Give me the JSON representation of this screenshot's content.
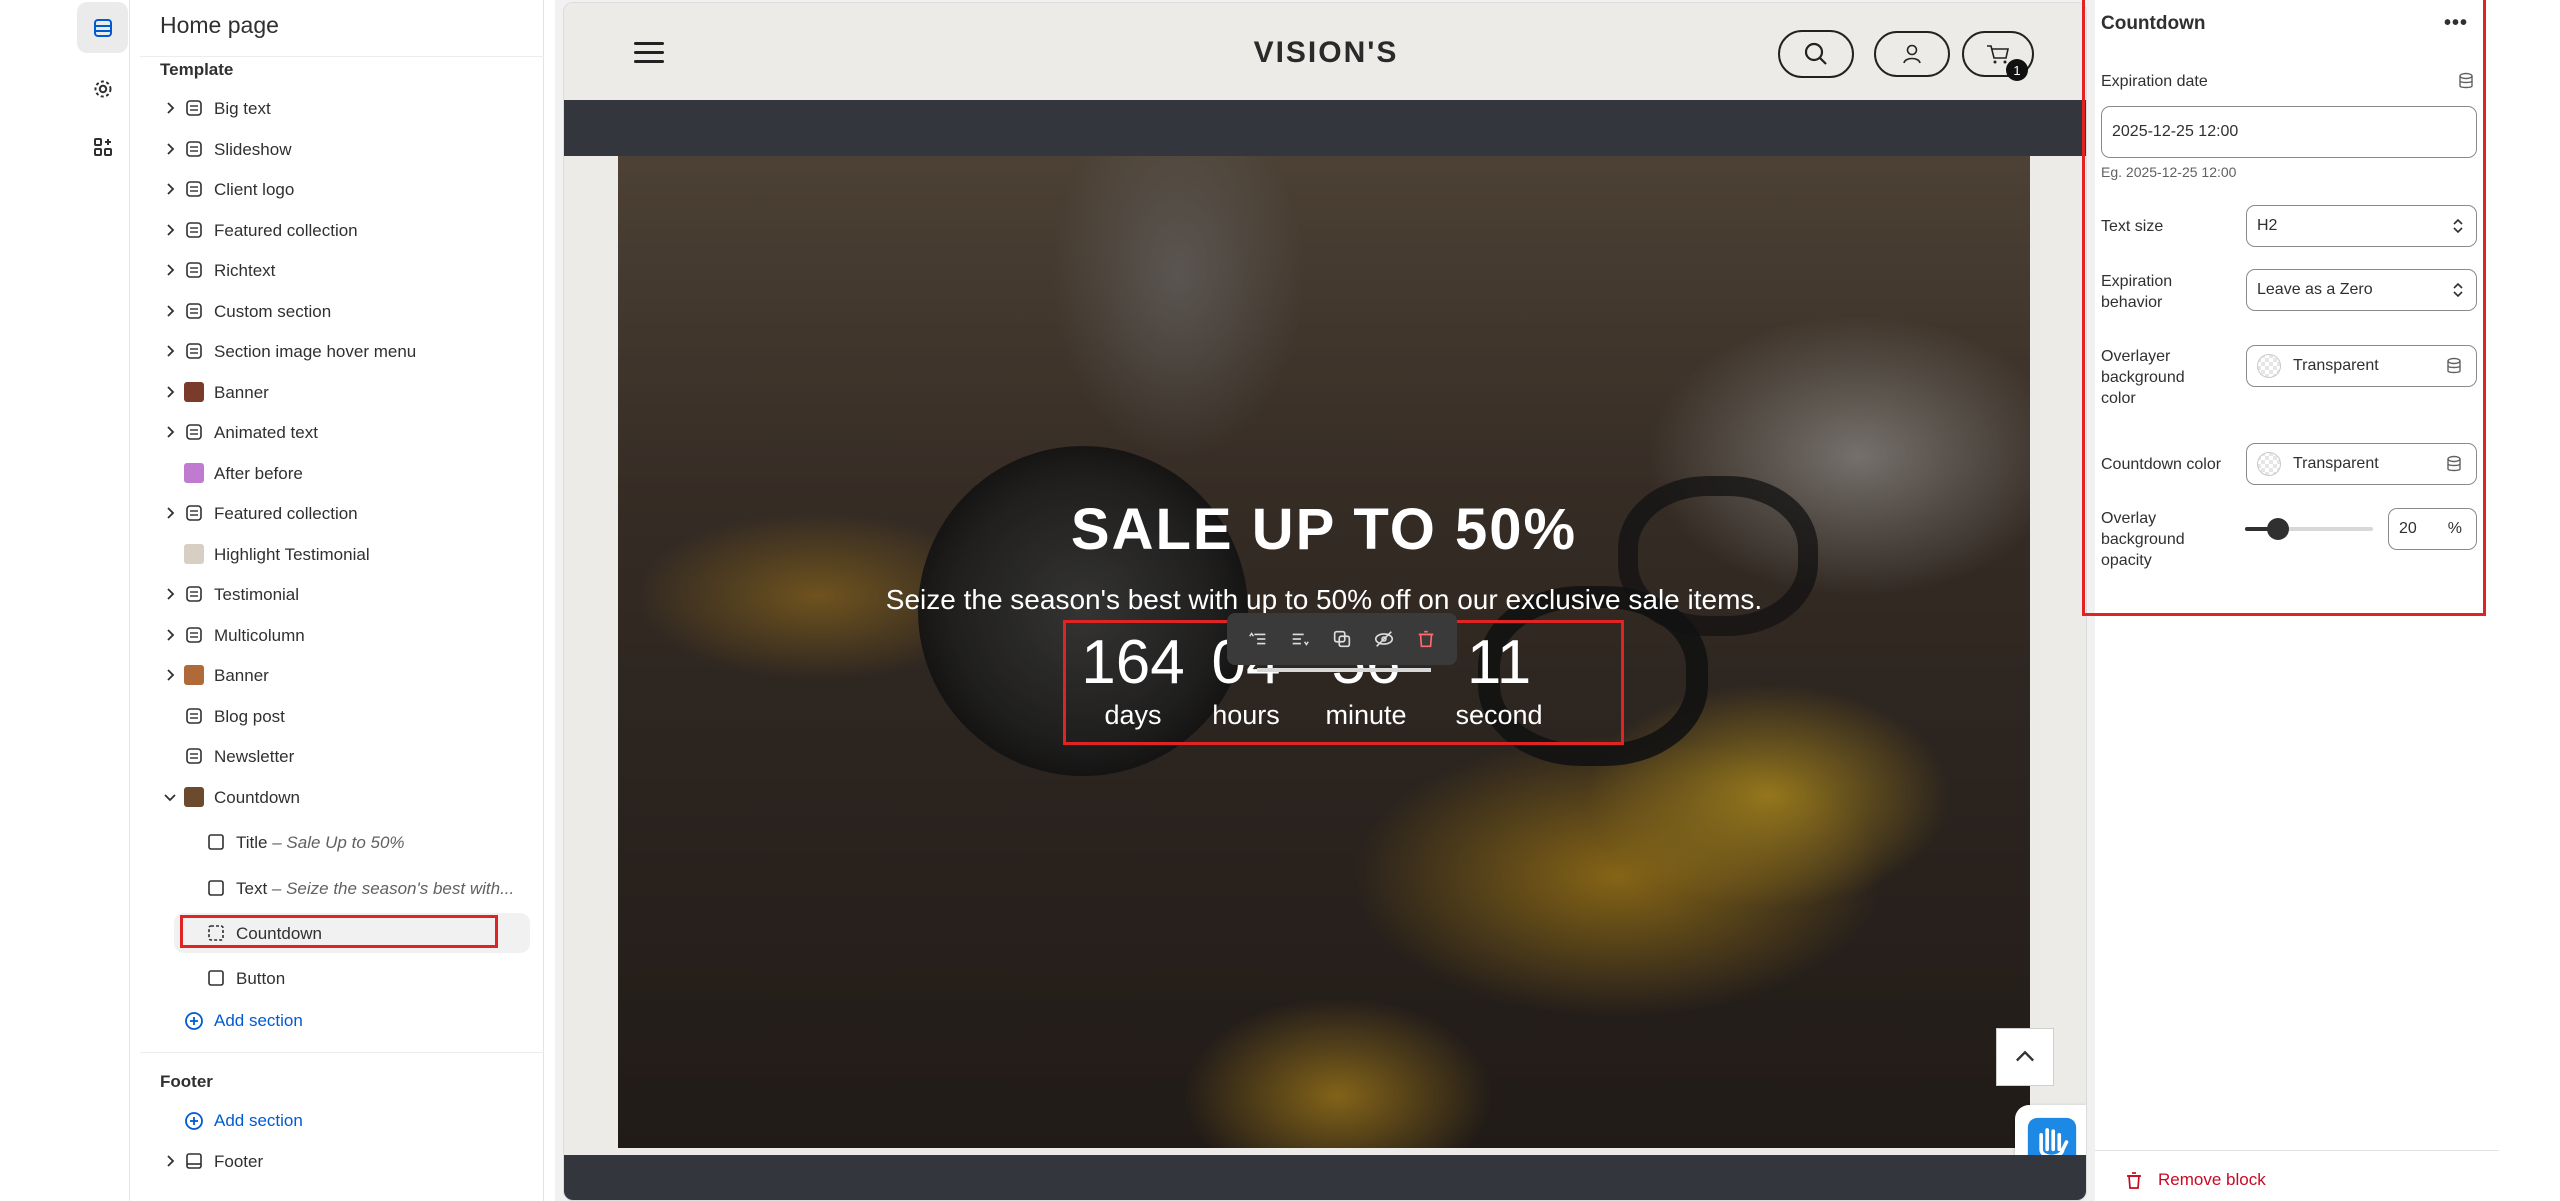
{
  "sidebar": {
    "title": "Home page",
    "template_heading": "Template",
    "items": [
      {
        "label": "Big text"
      },
      {
        "label": "Slideshow"
      },
      {
        "label": "Client logo"
      },
      {
        "label": "Featured collection"
      },
      {
        "label": "Richtext"
      },
      {
        "label": "Custom section"
      },
      {
        "label": "Section image hover menu"
      },
      {
        "label": "Banner"
      },
      {
        "label": "Animated text"
      },
      {
        "label": "After before"
      },
      {
        "label": "Featured collection"
      },
      {
        "label": "Highlight Testimonial"
      },
      {
        "label": "Testimonial"
      },
      {
        "label": "Multicolumn"
      },
      {
        "label": "Banner"
      },
      {
        "label": "Blog post"
      },
      {
        "label": "Newsletter"
      },
      {
        "label": "Countdown"
      }
    ],
    "countdown_children": [
      {
        "label": "Title",
        "sub": " – Sale Up to 50%"
      },
      {
        "label": "Text",
        "sub": " – Seize the season's best with..."
      },
      {
        "label": "Countdown",
        "sub": ""
      },
      {
        "label": "Button",
        "sub": ""
      }
    ],
    "add_section": "Add section",
    "footer_heading": "Footer",
    "footer_add_section": "Add section",
    "footer_item": "Footer"
  },
  "store": {
    "brand": "VISION'S",
    "cart_count": "1",
    "hero_title": "SALE UP TO 50%",
    "hero_text": "Seize the season's best with up to 50% off on our exclusive sale items.",
    "countdown": [
      {
        "value": "164",
        "label": "days"
      },
      {
        "value": "04",
        "label": "hours"
      },
      {
        "value": "56",
        "label": "minute"
      },
      {
        "value": "11",
        "label": "second"
      }
    ]
  },
  "settings": {
    "title": "Countdown",
    "more": "•••",
    "expiration_date_label": "Expiration date",
    "expiration_date_value": "2025-12-25 12:00",
    "expiration_date_hint": "Eg. 2025-12-25 12:00",
    "text_size_label": "Text size",
    "text_size_value": "H2",
    "expiration_behavior_label": "Expiration behavior",
    "expiration_behavior_value": "Leave as a Zero",
    "overlayer_bg_label": "Overlayer background color",
    "overlayer_bg_value": "Transparent",
    "countdown_color_label": "Countdown color",
    "countdown_color_value": "Transparent",
    "overlay_opacity_label": "Overlay background opacity",
    "overlay_opacity_value": "20",
    "overlay_opacity_unit": "%",
    "remove_block": "Remove block"
  },
  "colors": {
    "highlight": "#e02424",
    "link": "#005bd3",
    "danger": "#c70a24",
    "dark_band": "#33363d"
  }
}
